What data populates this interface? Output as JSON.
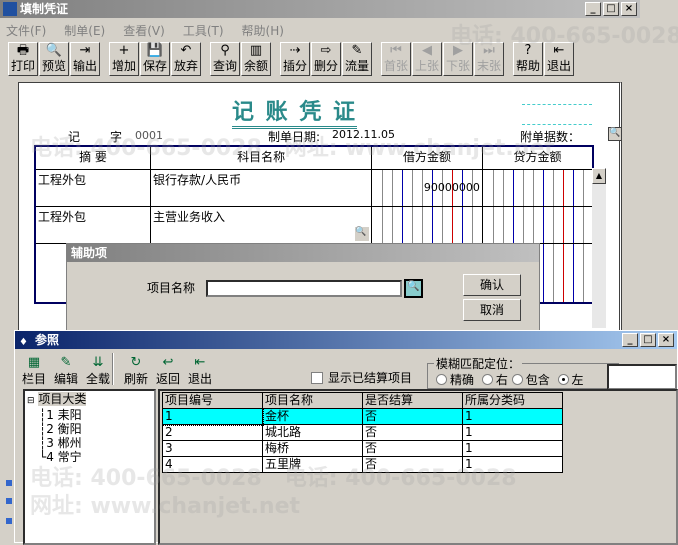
{
  "main_window": {
    "title": "填制凭证",
    "menu": [
      "文件(F)",
      "制单(E)",
      "查看(V)",
      "工具(T)",
      "帮助(H)"
    ],
    "toolbar": [
      {
        "label": "打印",
        "icon": "printer-icon"
      },
      {
        "label": "预览",
        "icon": "preview-icon"
      },
      {
        "label": "输出",
        "icon": "export-icon"
      },
      {
        "label": "增加",
        "icon": "add-icon"
      },
      {
        "label": "保存",
        "icon": "save-icon"
      },
      {
        "label": "放弃",
        "icon": "undo-icon"
      },
      {
        "label": "查询",
        "icon": "binoculars-icon"
      },
      {
        "label": "余额",
        "icon": "chart-icon"
      },
      {
        "label": "插分",
        "icon": "insert-row-icon"
      },
      {
        "label": "删分",
        "icon": "delete-row-icon"
      },
      {
        "label": "流量",
        "icon": "cashflow-icon"
      },
      {
        "label": "首张",
        "icon": "first-icon"
      },
      {
        "label": "上张",
        "icon": "prev-icon"
      },
      {
        "label": "下张",
        "icon": "next-icon"
      },
      {
        "label": "末张",
        "icon": "last-icon"
      },
      {
        "label": "帮助",
        "icon": "help-icon"
      },
      {
        "label": "退出",
        "icon": "exit-icon"
      }
    ]
  },
  "voucher": {
    "title": "记 账 凭 证",
    "type_label": "记",
    "zi_label": "字",
    "number": "0001",
    "date_label": "制单日期:",
    "date": "2012.11.05",
    "attach_label": "附单据数：",
    "headers": [
      "摘 要",
      "科目名称",
      "借方金额",
      "贷方金额"
    ],
    "rows": [
      {
        "summary": "工程外包",
        "account": "银行存款/人民币",
        "debit": "90000000",
        "credit": ""
      },
      {
        "summary": "工程外包",
        "account": "主营业务收入",
        "debit": "",
        "credit": ""
      }
    ]
  },
  "aux_dialog": {
    "title": "辅助项",
    "field_label": "项目名称",
    "field_value": "",
    "ok": "确认",
    "cancel": "取消"
  },
  "ref_window": {
    "title": "参照",
    "toolbar": [
      {
        "label": "栏目",
        "icon": "columns-icon"
      },
      {
        "label": "编辑",
        "icon": "edit-icon"
      },
      {
        "label": "全载",
        "icon": "load-all-icon"
      },
      {
        "label": "刷新",
        "icon": "refresh-icon"
      },
      {
        "label": "返回",
        "icon": "return-icon"
      },
      {
        "label": "退出",
        "icon": "exit-icon"
      }
    ],
    "show_settled": "显示已结算项目",
    "fuzzy_label": "模糊匹配定位：",
    "fuzzy_options": [
      "精确",
      "右",
      "包含",
      "左"
    ],
    "fuzzy_selected": "左",
    "tree": {
      "root": "项目大类",
      "children": [
        "1 耒阳",
        "2 衡阳",
        "3 郴州",
        "4 常宁"
      ]
    },
    "columns": [
      "项目编号",
      "项目名称",
      "是否结算",
      "所属分类码"
    ],
    "rows": [
      [
        "1",
        "金杯",
        "否",
        "1"
      ],
      [
        "2",
        "城北路",
        "否",
        "1"
      ],
      [
        "3",
        "梅桥",
        "否",
        "1"
      ],
      [
        "4",
        "五里牌",
        "否",
        "1"
      ]
    ]
  },
  "colors": {
    "teal": "#2a8a8a",
    "selected_row": "#00ffff"
  }
}
